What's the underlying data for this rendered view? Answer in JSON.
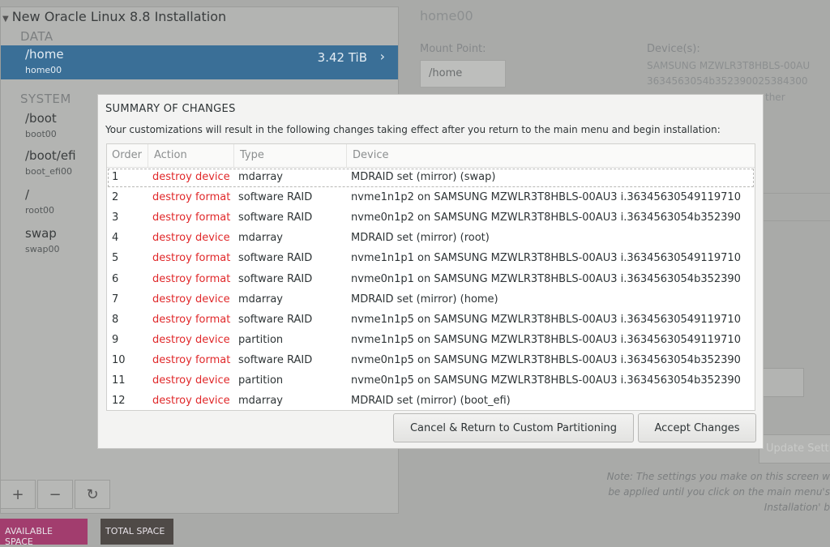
{
  "left": {
    "title": "New Oracle Linux 8.8 Installation",
    "data_category": "DATA",
    "system_category": "SYSTEM",
    "selected": {
      "mount": "/home",
      "device": "home00",
      "size": "3.42 TiB"
    },
    "mounts": [
      {
        "mount": "/boot",
        "device": "boot00"
      },
      {
        "mount": "/boot/efi",
        "device": "boot_efi00"
      },
      {
        "mount": "/",
        "device": "root00"
      },
      {
        "mount": "swap",
        "device": "swap00"
      }
    ],
    "toolbar": {
      "add": "+",
      "remove": "−",
      "refresh": "↻"
    },
    "available_space": "AVAILABLE SPACE",
    "total_space": "TOTAL SPACE"
  },
  "right": {
    "title": "home00",
    "mount_point_label": "Mount Point:",
    "mount_point_value": "/home",
    "devices_label": "Device(s):",
    "device_line1": "SAMSUNG MZWLR3T8HBLS-00AU",
    "device_line2": "3634563054b352390025384300",
    "device_line3": "ther",
    "update_button": "Update Setti",
    "note_line1": "Note:  The settings you make on this screen w",
    "note_line2": "be applied until you click on the main menu's",
    "note_line3": "Installation' b"
  },
  "dialog": {
    "title": "SUMMARY OF CHANGES",
    "description": "Your customizations will result in the following changes taking effect after you return to the main menu and begin installation:",
    "columns": {
      "order": "Order",
      "action": "Action",
      "type": "Type",
      "device": "Device"
    },
    "rows": [
      {
        "order": "1",
        "action": "destroy device",
        "type": "mdarray",
        "device": "MDRAID set (mirror) (swap)"
      },
      {
        "order": "2",
        "action": "destroy format",
        "type": "software RAID",
        "device": "nvme1n1p2 on SAMSUNG MZWLR3T8HBLS-00AU3 i.36345630549119710"
      },
      {
        "order": "3",
        "action": "destroy format",
        "type": "software RAID",
        "device": "nvme0n1p2 on SAMSUNG MZWLR3T8HBLS-00AU3 i.3634563054b352390"
      },
      {
        "order": "4",
        "action": "destroy device",
        "type": "mdarray",
        "device": "MDRAID set (mirror) (root)"
      },
      {
        "order": "5",
        "action": "destroy format",
        "type": "software RAID",
        "device": "nvme1n1p1 on SAMSUNG MZWLR3T8HBLS-00AU3 i.36345630549119710"
      },
      {
        "order": "6",
        "action": "destroy format",
        "type": "software RAID",
        "device": "nvme0n1p1 on SAMSUNG MZWLR3T8HBLS-00AU3 i.3634563054b352390"
      },
      {
        "order": "7",
        "action": "destroy device",
        "type": "mdarray",
        "device": "MDRAID set (mirror) (home)"
      },
      {
        "order": "8",
        "action": "destroy format",
        "type": "software RAID",
        "device": "nvme1n1p5 on SAMSUNG MZWLR3T8HBLS-00AU3 i.36345630549119710"
      },
      {
        "order": "9",
        "action": "destroy device",
        "type": "partition",
        "device": "nvme1n1p5 on SAMSUNG MZWLR3T8HBLS-00AU3 i.36345630549119710"
      },
      {
        "order": "10",
        "action": "destroy format",
        "type": "software RAID",
        "device": "nvme0n1p5 on SAMSUNG MZWLR3T8HBLS-00AU3 i.3634563054b352390"
      },
      {
        "order": "11",
        "action": "destroy device",
        "type": "partition",
        "device": "nvme0n1p5 on SAMSUNG MZWLR3T8HBLS-00AU3 i.3634563054b352390"
      },
      {
        "order": "12",
        "action": "destroy device",
        "type": "mdarray",
        "device": "MDRAID set (mirror) (boot_efi)"
      }
    ],
    "cancel_button": "Cancel & Return to Custom Partitioning",
    "accept_button": "Accept Changes"
  },
  "colors": {
    "destroy_action": "#e0282a",
    "selected_row": "#3a6f97",
    "available_space": "#a23d6e",
    "total_space": "#4f4a47"
  }
}
